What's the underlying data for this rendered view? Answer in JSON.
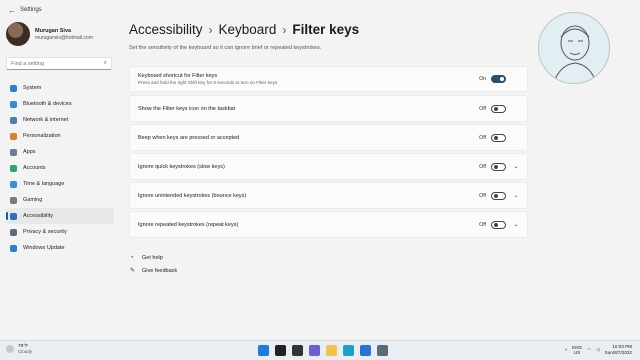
{
  "window": {
    "title": "Settings"
  },
  "profile": {
    "name": "Murugan Siva",
    "email": "murugansiv@hotmail.com"
  },
  "search": {
    "placeholder": "Find a setting"
  },
  "sidebar": {
    "items": [
      {
        "label": "System",
        "icon": "monitor-icon",
        "color": "#2b7fd4"
      },
      {
        "label": "Bluetooth & devices",
        "icon": "bluetooth-icon",
        "color": "#3a86d8"
      },
      {
        "label": "Network & internet",
        "icon": "wifi-icon",
        "color": "#4a7fb3"
      },
      {
        "label": "Personalization",
        "icon": "brush-icon",
        "color": "#d9822b"
      },
      {
        "label": "Apps",
        "icon": "apps-icon",
        "color": "#6b7c93"
      },
      {
        "label": "Accounts",
        "icon": "person-icon",
        "color": "#2fa36b"
      },
      {
        "label": "Time & language",
        "icon": "globe-clock-icon",
        "color": "#3a8fd8"
      },
      {
        "label": "Gaming",
        "icon": "controller-icon",
        "color": "#7a7a7a"
      },
      {
        "label": "Accessibility",
        "icon": "accessibility-icon",
        "color": "#2f6fb5"
      },
      {
        "label": "Privacy & security",
        "icon": "shield-icon",
        "color": "#5b6b7d"
      },
      {
        "label": "Windows Update",
        "icon": "update-icon",
        "color": "#2b7fd4"
      }
    ],
    "active_index": 8
  },
  "breadcrumb": {
    "level1": "Accessibility",
    "level2": "Keyboard",
    "current": "Filter keys"
  },
  "subtitle": "Set the sensitivity of the keyboard so it can ignore brief or repeated keystrokes.",
  "settings": [
    {
      "label": "Keyboard shortcut for Filter keys",
      "desc": "Press and hold the right Shift key for 8 seconds to turn on Filter keys",
      "state": "On",
      "on": true,
      "expandable": false
    },
    {
      "label": "Show the Filter keys icon on the taskbar",
      "desc": "",
      "state": "Off",
      "on": false,
      "expandable": false
    },
    {
      "label": "Beep when keys are pressed or accepted",
      "desc": "",
      "state": "Off",
      "on": false,
      "expandable": false
    },
    {
      "label": "Ignore quick keystrokes (slow keys)",
      "desc": "",
      "state": "Off",
      "on": false,
      "expandable": true
    },
    {
      "label": "Ignore unintended keystrokes (bounce keys)",
      "desc": "",
      "state": "Off",
      "on": false,
      "expandable": true
    },
    {
      "label": "Ignore repeated keystrokes (repeat keys)",
      "desc": "",
      "state": "Off",
      "on": false,
      "expandable": true
    }
  ],
  "links": {
    "help": "Get help",
    "feedback": "Give feedback"
  },
  "taskbar": {
    "weather_temp": "78°F",
    "weather_cond": "Cloudy",
    "lang": "ENG",
    "region": "US",
    "time": "10:03 PM",
    "date": "Sun/8/7/2022",
    "icons": [
      {
        "name": "start-icon",
        "color": "#1f7ae0"
      },
      {
        "name": "search-icon",
        "color": "#222222"
      },
      {
        "name": "task-view-icon",
        "color": "#333333"
      },
      {
        "name": "chat-icon",
        "color": "#6b5fd6"
      },
      {
        "name": "file-explorer-icon",
        "color": "#f2c14e"
      },
      {
        "name": "edge-icon",
        "color": "#1fa0c9"
      },
      {
        "name": "store-icon",
        "color": "#2b6fd8"
      },
      {
        "name": "settings-gear-icon",
        "color": "#5a6b7b"
      }
    ]
  }
}
